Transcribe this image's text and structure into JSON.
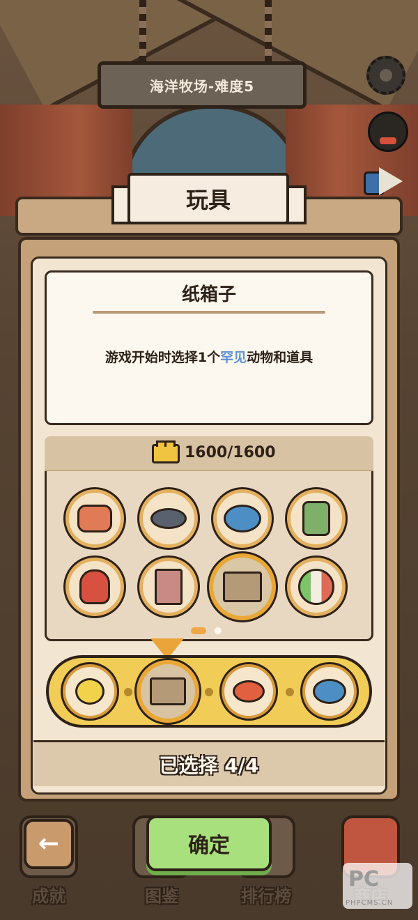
{
  "level_sign": {
    "text": "海洋牧场-难度5"
  },
  "panel": {
    "title": "玩具"
  },
  "selected_item": {
    "name": "纸箱子",
    "desc_prefix": "游戏开始时选择1个",
    "desc_highlight": "罕见",
    "desc_suffix": "动物和道具"
  },
  "points": {
    "text": "1600/1600",
    "icon": "brick-icon"
  },
  "toys": [
    {
      "name": "cat-bowl-icon",
      "selected": false
    },
    {
      "name": "collar-icon",
      "selected": false
    },
    {
      "name": "spring-toy-icon",
      "selected": false
    },
    {
      "name": "game-console-icon",
      "selected": false
    },
    {
      "name": "cat-doll-icon",
      "selected": false
    },
    {
      "name": "cat-tree-icon",
      "selected": false
    },
    {
      "name": "cardboard-box-icon",
      "selected": true
    },
    {
      "name": "beach-ball-icon",
      "selected": false
    }
  ],
  "page_dots": {
    "count": 2,
    "active": 0
  },
  "tray": [
    {
      "name": "duck-toy-icon",
      "active": false
    },
    {
      "name": "cardboard-box-icon",
      "active": true
    },
    {
      "name": "goldfish-icon",
      "active": false
    },
    {
      "name": "spring-toy-icon",
      "active": false
    }
  ],
  "status": {
    "text": "已选择 4/4"
  },
  "nav": {
    "achievements": "成就",
    "collection": "图鉴",
    "leaderboard": "排行榜",
    "shop": "商店"
  },
  "confirm_label": "确定",
  "back_label": "←",
  "watermark": {
    "logo": "PC",
    "url": "PHPCMS.CN"
  },
  "colors": {
    "accent_orange": "#e9a735",
    "confirm_green": "#a9e07e",
    "highlight_blue": "#5f90d6",
    "tray_yellow": "#f1cc57"
  }
}
